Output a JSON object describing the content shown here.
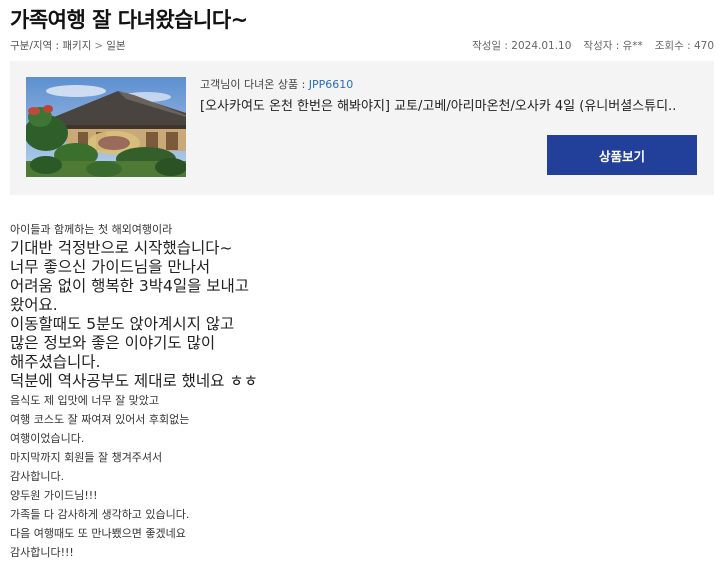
{
  "header": {
    "title": "가족여행 잘 다녀왔습니다~"
  },
  "breadcrumb": {
    "prefix": "구분/지역 : 패키지",
    "separator": ">",
    "current": "일본"
  },
  "post_info": {
    "date": "작성일 : 2024.01.10",
    "author": "작성자 : 유**",
    "views": "조회수 : 470"
  },
  "product": {
    "label_prefix": "고객님이 다녀온 상품 : ",
    "code": "JPP6610",
    "name": "[오사카여도 온천 한번은 해봐야지] 교토/고베/아리마온천/오사카 4일 (유니버셜스튜디..",
    "button_label": "상품보기",
    "thumbnail_icon": "japanese-garden-photo"
  },
  "body": {
    "lines": [
      {
        "text": "아이들과 함께하는 첫 해외여행이라",
        "size": "small"
      },
      {
        "text": "기대반 걱정반으로 시작했습니다~",
        "size": "large"
      },
      {
        "text": "너무 좋으신 가이드님을 만나서",
        "size": "large"
      },
      {
        "text": "어려움 없이 행복한 3박4일을 보내고",
        "size": "large"
      },
      {
        "text": "왔어요.",
        "size": "large"
      },
      {
        "text": "이동할때도 5분도 앉아계시지 않고",
        "size": "large"
      },
      {
        "text": "많은 정보와 좋은 이야기도 많이",
        "size": "large"
      },
      {
        "text": "해주셨습니다.",
        "size": "large"
      },
      {
        "text": "덕분에 역사공부도 제대로 했네요 ㅎㅎ",
        "size": "large"
      },
      {
        "text": "음식도 제 입맛에 너무 잘 맞았고",
        "size": "small"
      },
      {
        "text": "여행 코스도 잘 짜여져 있어서 후회없는",
        "size": "small"
      },
      {
        "text": "여행이었습니다.",
        "size": "small"
      },
      {
        "text": "마지막까지 회원들 잘 챙겨주셔서",
        "size": "small"
      },
      {
        "text": "감사합니다.",
        "size": "small"
      },
      {
        "text": "양두원 가이드님!!!",
        "size": "small"
      },
      {
        "text": "가족들 다 감사하게 생각하고 있습니다.",
        "size": "small"
      },
      {
        "text": "다음 여행때도 또 만나뵀으면 좋겠네요",
        "size": "small"
      },
      {
        "text": "감사합니다!!!",
        "size": "small"
      }
    ]
  },
  "colors": {
    "button_bg": "#22409a",
    "product_code": "#2a6ac8",
    "box_bg": "#f4f4f4"
  }
}
